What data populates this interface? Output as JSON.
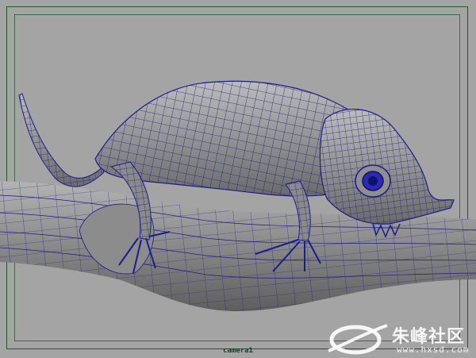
{
  "viewport": {
    "camera_label": "camera1",
    "background": "#a4a4a4",
    "wire_color": "#1c1c8a",
    "shade_color": "#8a8a8a"
  },
  "watermark": {
    "title": "朱峰社区",
    "url": "www.hxsd.com"
  }
}
